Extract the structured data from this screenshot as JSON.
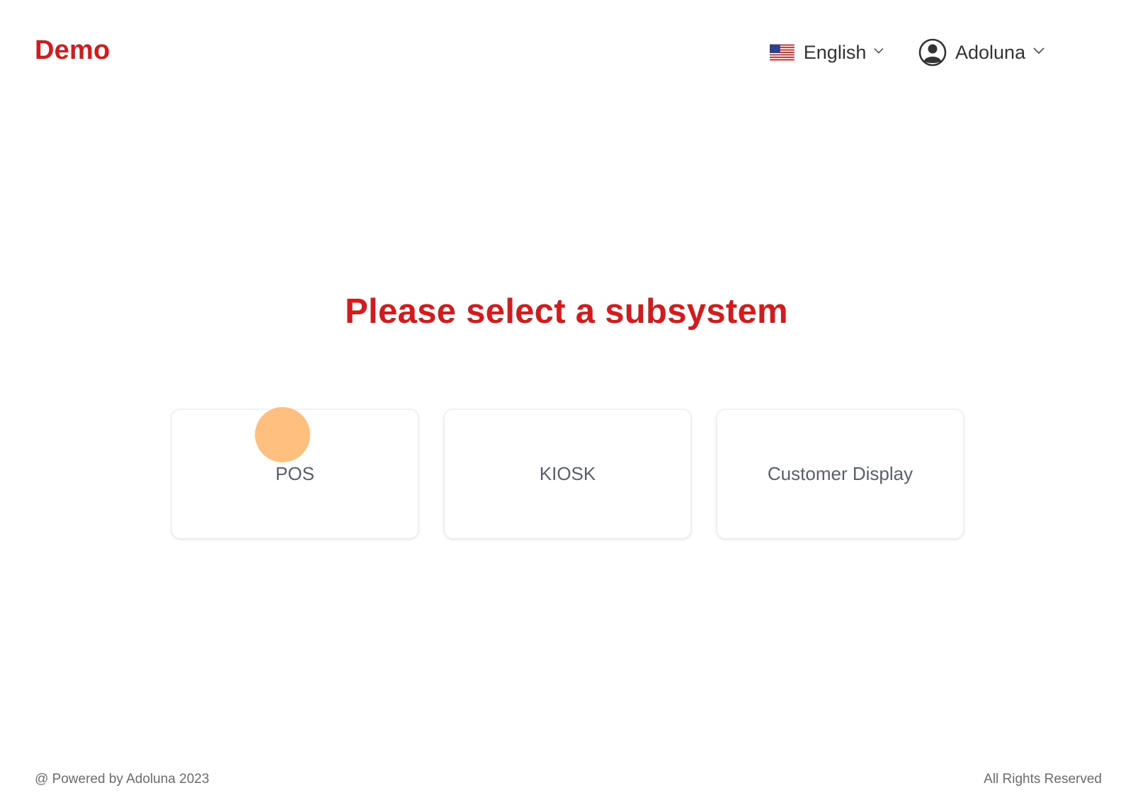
{
  "header": {
    "brand": "Demo",
    "language": {
      "label": "English",
      "flag_icon": "us-flag-icon"
    },
    "user": {
      "name": "Adoluna",
      "icon": "user-circle-icon"
    }
  },
  "main": {
    "heading": "Please select a subsystem",
    "subsystems": [
      {
        "label": "POS"
      },
      {
        "label": "KIOSK"
      },
      {
        "label": "Customer Display"
      }
    ]
  },
  "footer": {
    "left": "@ Powered by Adoluna 2023",
    "right": "All Rights Reserved"
  },
  "colors": {
    "brand_red": "#d8191c",
    "card_text": "#58616b",
    "cursor_highlight": "#ffc07f"
  }
}
